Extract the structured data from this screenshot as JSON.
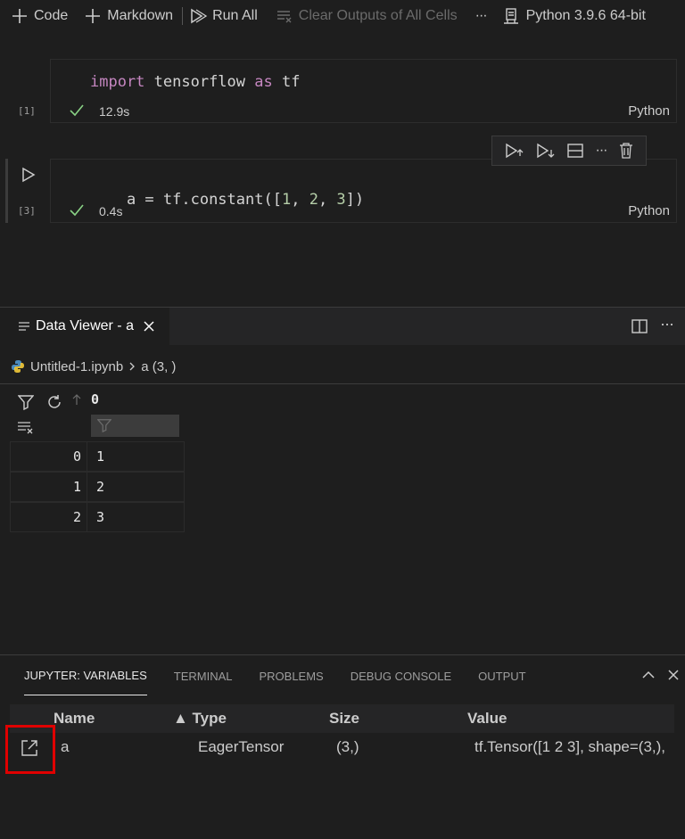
{
  "toolbar": {
    "code_label": "Code",
    "markdown_label": "Markdown",
    "run_all_label": "Run All",
    "clear_outputs_label": "Clear Outputs of All Cells",
    "more_label": "···",
    "kernel_label": "Python 3.9.6 64-bit"
  },
  "cells": [
    {
      "exec_count": "[1]",
      "code_kw": "import",
      "code_mid": " tensorflow ",
      "code_kw2": "as",
      "code_end": " tf",
      "time": "12.9s",
      "language": "Python"
    },
    {
      "exec_count": "[3]",
      "code_prefix": "a = tf.constant([",
      "n1": "1",
      "sep1": ", ",
      "n2": "2",
      "sep2": ", ",
      "n3": "3",
      "code_suffix": "])",
      "time": "0.4s",
      "language": "Python"
    }
  ],
  "data_viewer": {
    "tab_title": "Data Viewer - a",
    "breadcrumb_file": "Untitled-1.ipynb",
    "breadcrumb_var": "a (3, )",
    "column_header": "0",
    "rows": [
      {
        "index": "0",
        "value": "1"
      },
      {
        "index": "1",
        "value": "2"
      },
      {
        "index": "2",
        "value": "3"
      }
    ]
  },
  "panel": {
    "tabs": [
      "JUPYTER: VARIABLES",
      "TERMINAL",
      "PROBLEMS",
      "DEBUG CONSOLE",
      "OUTPUT"
    ],
    "active_tab": "JUPYTER: VARIABLES",
    "columns": {
      "name": "Name",
      "type": "▲ Type",
      "size": "Size",
      "value": "Value"
    },
    "variables": [
      {
        "name": "a",
        "type": "EagerTensor",
        "size": "(3,)",
        "value": "tf.Tensor([1 2 3], shape=(3,),"
      }
    ]
  },
  "colors": {
    "background": "#1e1e1e",
    "keyword": "#c586c0",
    "number": "#b5cea8",
    "success_check": "#89d185",
    "highlight": "#e00000"
  }
}
